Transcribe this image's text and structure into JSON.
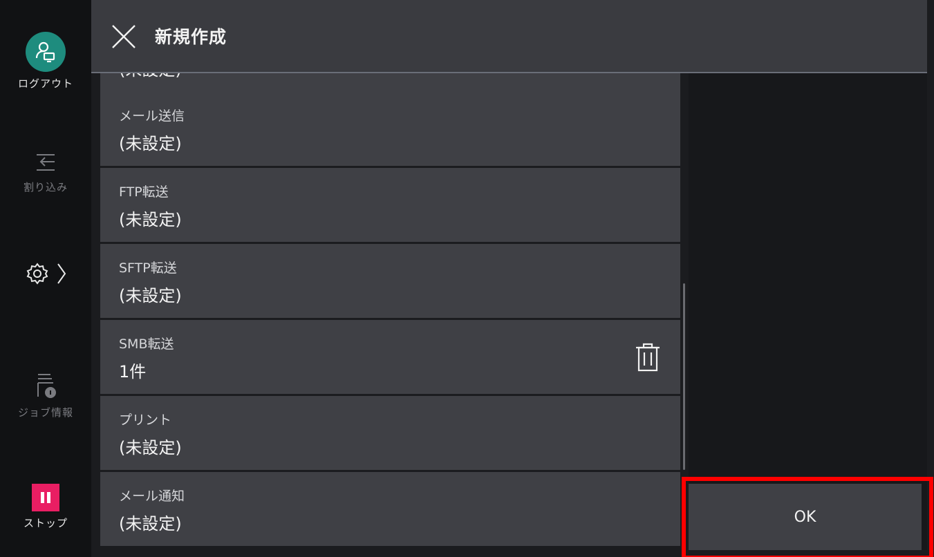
{
  "header": {
    "title": "新規作成"
  },
  "sidebar": {
    "logout_label": "ログアウト",
    "interrupt_label": "割り込み",
    "job_info_label": "ジョブ情報",
    "stop_label": "ストップ"
  },
  "list": {
    "partial_value": "(未設定)",
    "rows": [
      {
        "label": "メール送信",
        "value": "(未設定)"
      },
      {
        "label": "FTP転送",
        "value": "(未設定)"
      },
      {
        "label": "SFTP転送",
        "value": "(未設定)"
      },
      {
        "label": "SMB転送",
        "value": "1件"
      },
      {
        "label": "プリント",
        "value": "(未設定)"
      },
      {
        "label": "メール通知",
        "value": "(未設定)"
      }
    ]
  },
  "footer": {
    "ok_label": "OK"
  },
  "colors": {
    "accent_teal": "#1e8c7e",
    "stop_pink": "#e91e63",
    "highlight_red": "#ff0000"
  }
}
